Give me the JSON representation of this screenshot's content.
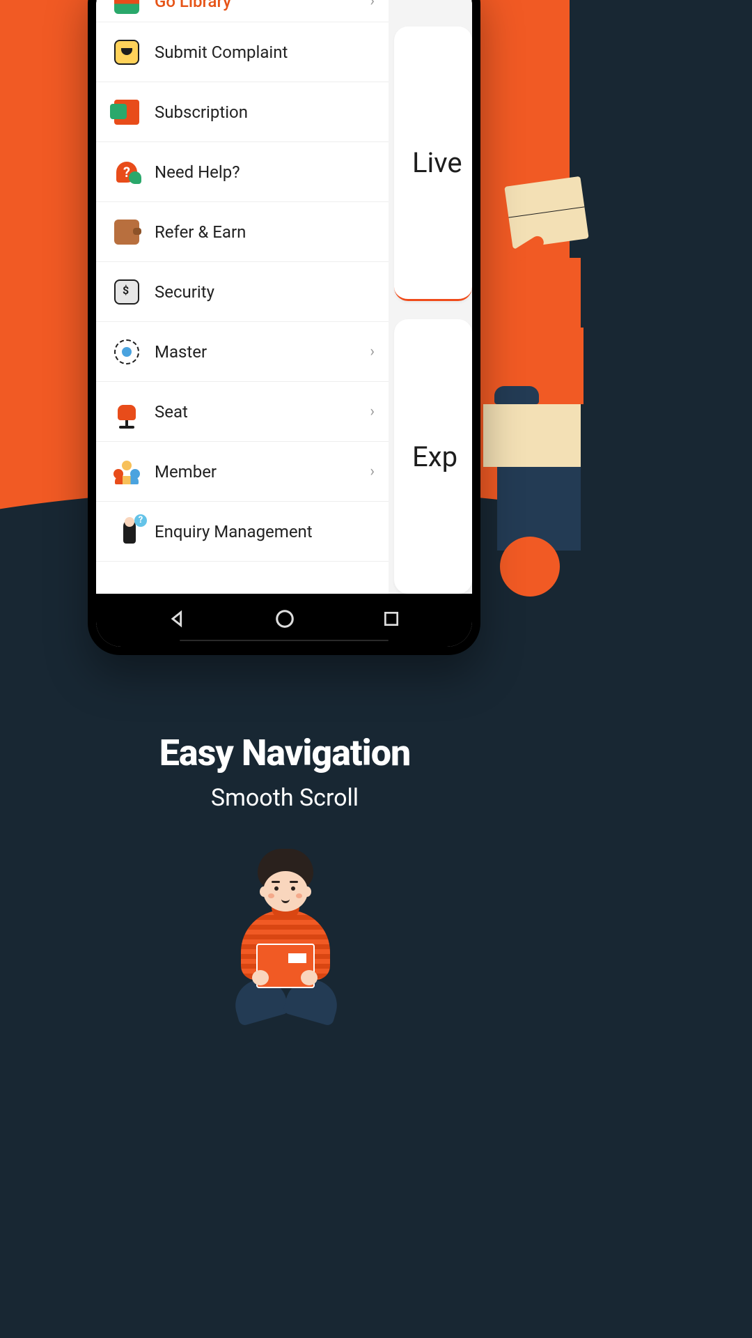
{
  "hero": {
    "title": "Easy Navigation",
    "subtitle": "Smooth Scroll"
  },
  "drawer": {
    "items": [
      {
        "label": "Go Library",
        "icon": "books-icon",
        "accent": true,
        "chevron": true
      },
      {
        "label": "Submit Complaint",
        "icon": "complaint-icon"
      },
      {
        "label": "Subscription",
        "icon": "subscription-icon"
      },
      {
        "label": "Need Help?",
        "icon": "help-icon"
      },
      {
        "label": "Refer & Earn",
        "icon": "wallet-icon"
      },
      {
        "label": "Security",
        "icon": "security-icon"
      },
      {
        "label": "Master",
        "icon": "master-icon",
        "chevron": true
      },
      {
        "label": "Seat",
        "icon": "seat-icon",
        "chevron": true
      },
      {
        "label": "Member",
        "icon": "member-icon",
        "chevron": true
      },
      {
        "label": "Enquiry Management",
        "icon": "enquiry-icon"
      }
    ]
  },
  "main": {
    "card1": "Live",
    "card2": "Exp"
  },
  "colors": {
    "accent": "#f15a24",
    "dark": "#182733"
  }
}
